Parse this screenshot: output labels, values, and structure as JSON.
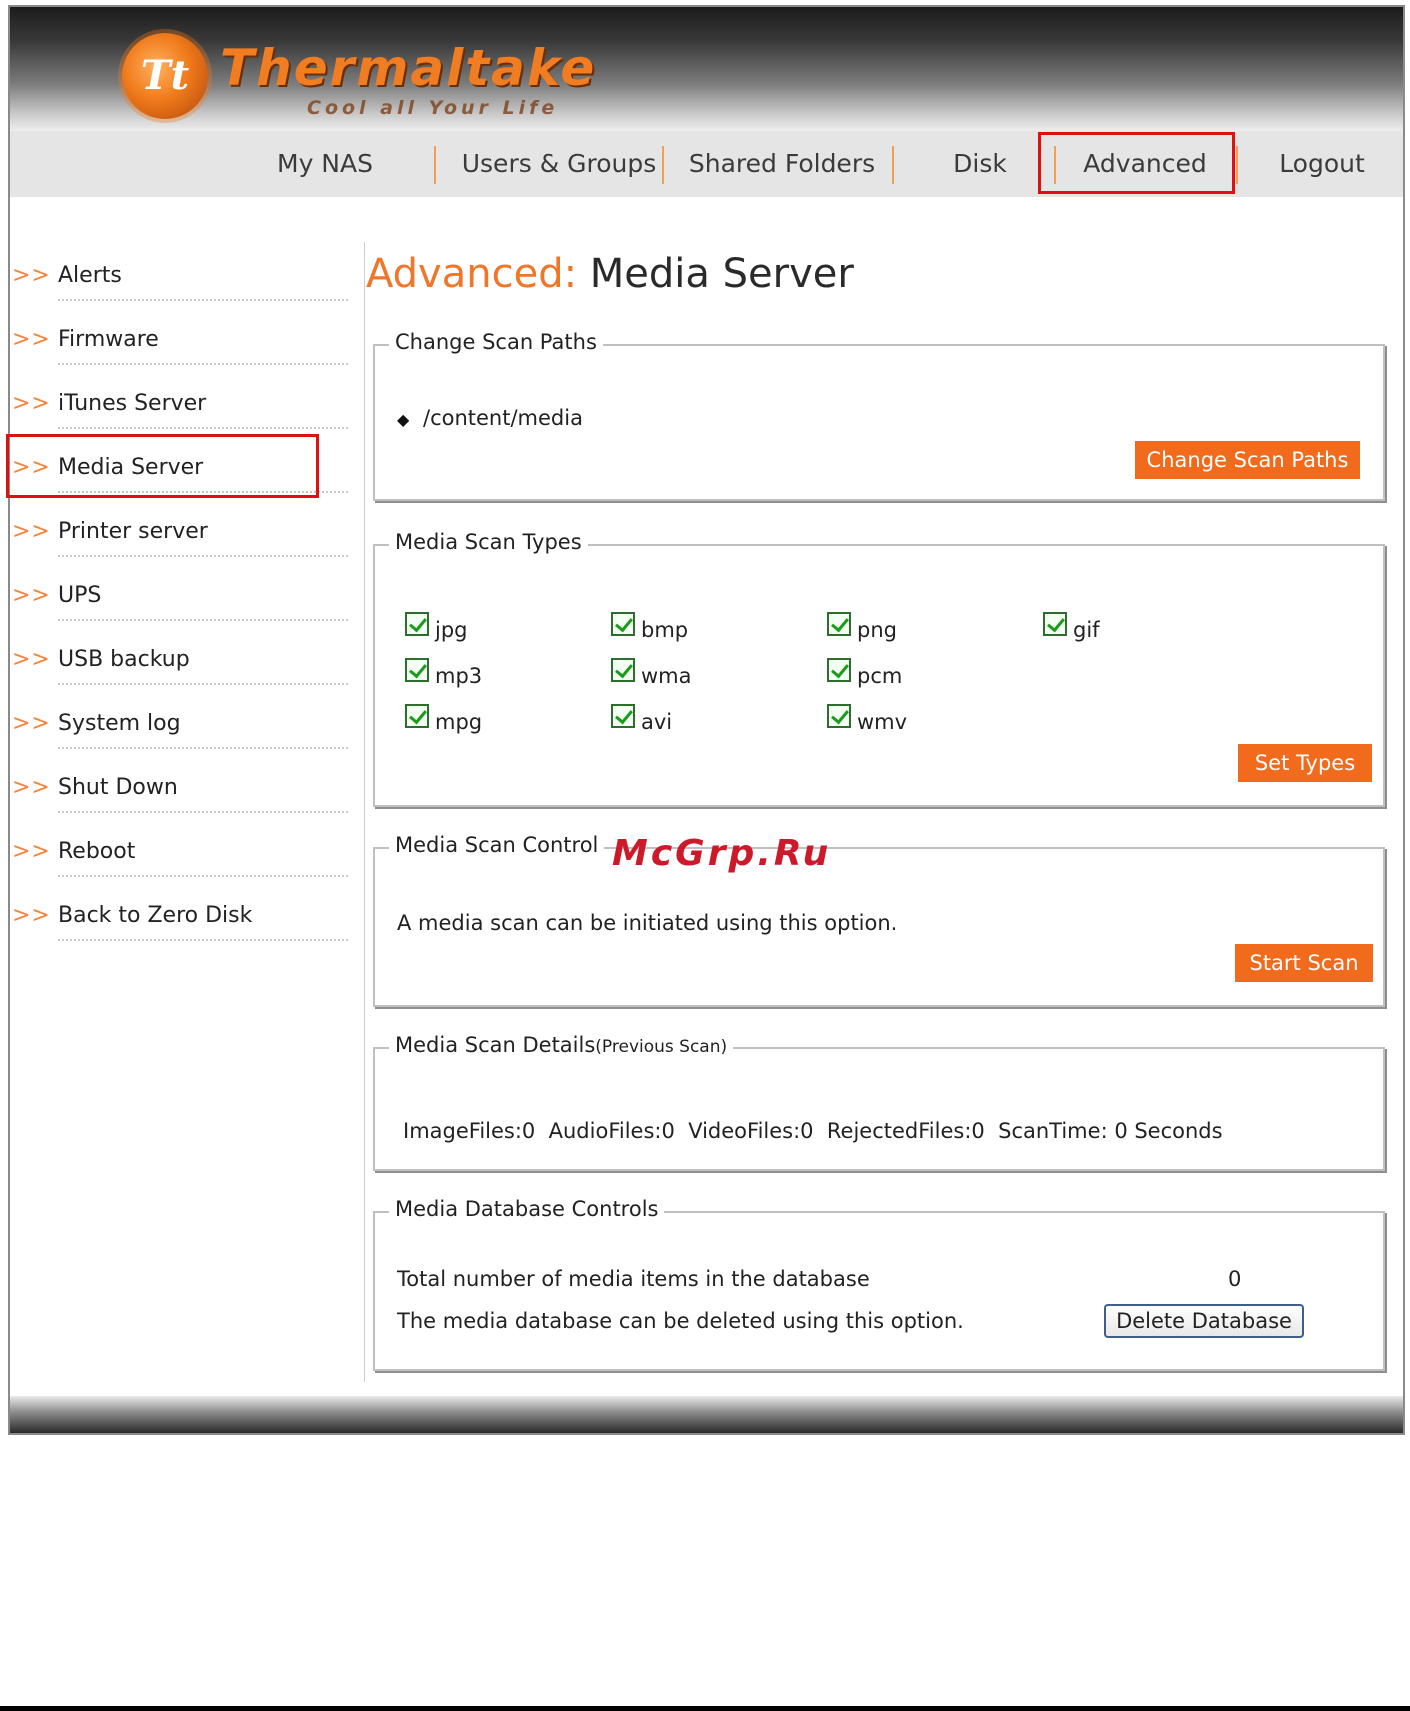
{
  "brand": {
    "logo_mark": "Tt",
    "logo_text": "Thermaltake",
    "tagline": "Cool all Your Life"
  },
  "nav": {
    "items": [
      {
        "label": "My NAS"
      },
      {
        "label": "Users & Groups"
      },
      {
        "label": "Shared Folders"
      },
      {
        "label": "Disk"
      },
      {
        "label": "Advanced",
        "selected": true
      },
      {
        "label": "Logout"
      }
    ]
  },
  "sidebar": {
    "arrow": ">>",
    "items": [
      {
        "label": "Alerts"
      },
      {
        "label": "Firmware"
      },
      {
        "label": "iTunes Server"
      },
      {
        "label": "Media Server",
        "selected": true
      },
      {
        "label": "Printer server"
      },
      {
        "label": "UPS"
      },
      {
        "label": "USB backup"
      },
      {
        "label": "System log"
      },
      {
        "label": "Shut Down"
      },
      {
        "label": "Reboot"
      },
      {
        "label": "Back to Zero Disk"
      }
    ]
  },
  "main": {
    "title_section": "Advanced:",
    "title_page": "Media Server",
    "scan_paths": {
      "legend": "Change Scan Paths",
      "path": "/content/media",
      "button": "Change Scan Paths"
    },
    "scan_types": {
      "legend": "Media Scan Types",
      "types": [
        {
          "label": "jpg",
          "checked": true
        },
        {
          "label": "bmp",
          "checked": true
        },
        {
          "label": "png",
          "checked": true
        },
        {
          "label": "gif",
          "checked": true
        },
        {
          "label": "mp3",
          "checked": true
        },
        {
          "label": "wma",
          "checked": true
        },
        {
          "label": "pcm",
          "checked": true
        },
        {
          "label": "mpg",
          "checked": true
        },
        {
          "label": "avi",
          "checked": true
        },
        {
          "label": "wmv",
          "checked": true
        }
      ],
      "button": "Set Types"
    },
    "scan_control": {
      "legend": "Media Scan Control",
      "description": "A media scan can be initiated using this option.",
      "button": "Start Scan"
    },
    "scan_details": {
      "legend": "Media Scan Details",
      "legend_note": "(Previous Scan)",
      "summary": "ImageFiles:0  AudioFiles:0  VideoFiles:0  RejectedFiles:0  ScanTime: 0 Seconds"
    },
    "database": {
      "legend": "Media Database Controls",
      "total_label": "Total number of media items in the database",
      "total_value": "0",
      "delete_description": "The media database can be deleted using this option.",
      "delete_button": "Delete Database"
    }
  },
  "watermark": "McGrp.Ru",
  "colors": {
    "accent_orange": "#f26a1b",
    "highlight_red": "#e01010",
    "check_green": "#1c9a1c"
  }
}
